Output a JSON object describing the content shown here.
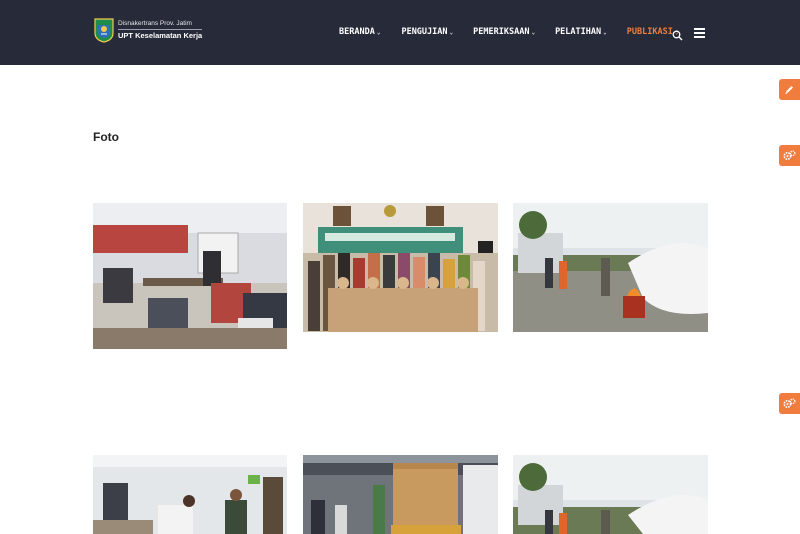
{
  "header": {
    "logo_line1": "Disnakertrans Prov. Jatim",
    "logo_line2": "UPT Keselamatan Kerja",
    "menu": [
      {
        "label": "BERANDA",
        "active": false
      },
      {
        "label": "PENGUJIAN",
        "active": false
      },
      {
        "label": "PEMERIKSAAN",
        "active": false
      },
      {
        "label": "PELATIHAN",
        "active": false
      },
      {
        "label": "PUBLIKASI",
        "active": true
      }
    ],
    "chevron": "⌄",
    "icons": [
      "search-icon",
      "menu-icon"
    ]
  },
  "main": {
    "heading": "Foto"
  },
  "gallery": {
    "photos": [
      {
        "subject": "training-classroom"
      },
      {
        "subject": "group-photo"
      },
      {
        "subject": "fire-drill"
      },
      {
        "subject": "office-room"
      },
      {
        "subject": "warehouse-inspection"
      },
      {
        "subject": "fire-drill"
      }
    ]
  },
  "side_tabs": [
    "pencil-icon",
    "gears-icon",
    "gears-icon"
  ],
  "colors": {
    "nav_bg": "#262a39",
    "accent": "#ef7f3f",
    "side_tab": "#f07c3e"
  }
}
